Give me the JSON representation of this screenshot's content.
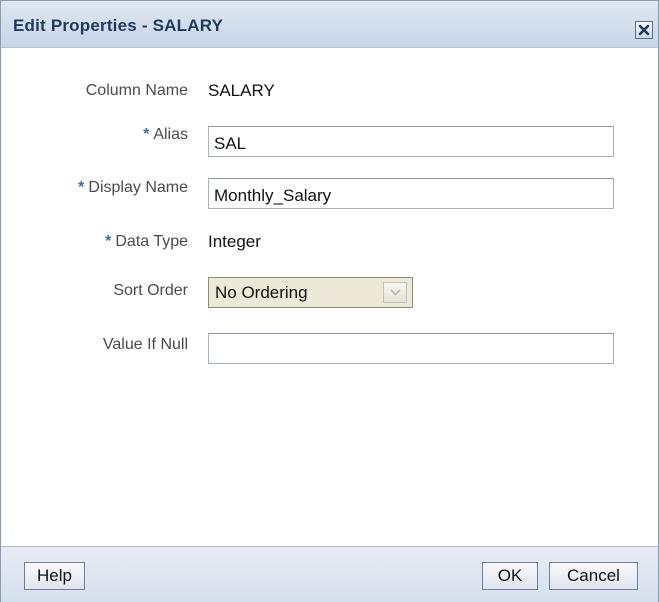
{
  "dialog": {
    "title": "Edit Properties - SALARY",
    "close_icon": "close-icon"
  },
  "form": {
    "column_name": {
      "label": "Column Name",
      "value": "SALARY",
      "required": false
    },
    "alias": {
      "label": "Alias",
      "value": "SAL",
      "required": true
    },
    "display_name": {
      "label": "Display Name",
      "value": "Monthly_Salary",
      "required": true
    },
    "data_type": {
      "label": "Data Type",
      "value": "Integer",
      "required": true
    },
    "sort_order": {
      "label": "Sort Order",
      "selected": "No Ordering"
    },
    "value_if_null": {
      "label": "Value If Null",
      "value": ""
    },
    "required_marker": "*"
  },
  "buttons": {
    "help": "Help",
    "ok": "OK",
    "cancel": "Cancel"
  },
  "colors": {
    "title_text": "#1f3a5f",
    "required_marker": "#3b6cb3",
    "label_text": "#4b4b4b"
  }
}
